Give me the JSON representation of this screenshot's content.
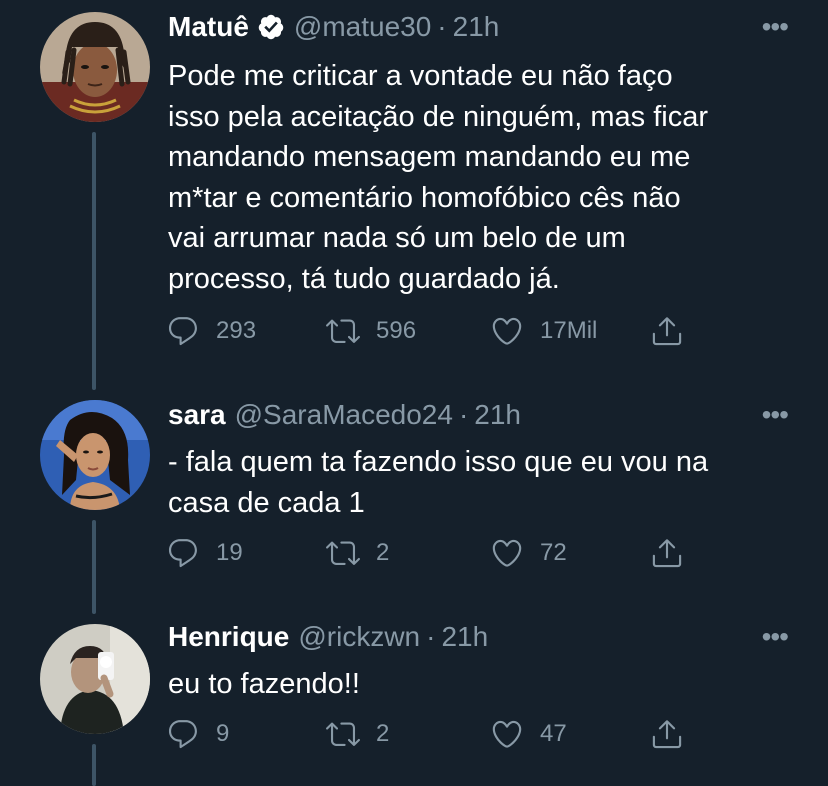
{
  "colors": {
    "background": "#15202b",
    "text_primary": "#ffffff",
    "text_secondary": "#8899a6",
    "thread_line": "#3d5466",
    "verified_badge": "#ffffff"
  },
  "tweets": [
    {
      "name": "Matuê",
      "verified": true,
      "handle": "@matue30",
      "separator": "·",
      "time": "21h",
      "more_icon": "more-horizontal-icon",
      "text_lines": [
        "Pode me criticar a vontade eu não faço",
        "isso pela aceitação de ninguém, mas ficar",
        "mandando mensagem mandando eu me",
        "m*tar e comentário homofóbico cês não",
        "vai arrumar nada só um belo de um",
        "processo, tá tudo guardado já."
      ],
      "replies": "293",
      "retweets": "596",
      "likes": "17Mil"
    },
    {
      "name": "sara",
      "verified": false,
      "handle": "@SaraMacedo24",
      "separator": "·",
      "time": "21h",
      "more_icon": "more-horizontal-icon",
      "text_lines": [
        "- fala quem ta fazendo isso que eu vou na",
        "casa de cada 1"
      ],
      "replies": "19",
      "retweets": "2",
      "likes": "72"
    },
    {
      "name": "Henrique",
      "verified": false,
      "handle": "@rickzwn",
      "separator": "·",
      "time": "21h",
      "more_icon": "more-horizontal-icon",
      "text_lines": [
        "eu to fazendo!!"
      ],
      "replies": "9",
      "retweets": "2",
      "likes": "47"
    }
  ],
  "more_label": "•••"
}
